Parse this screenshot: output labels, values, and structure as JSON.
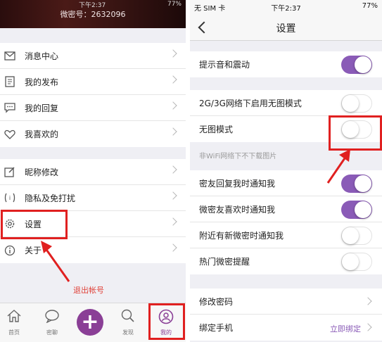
{
  "left": {
    "header": {
      "status_time": "下午2:37",
      "battery": "77%",
      "wechat_id": "微密号：2632096"
    },
    "menu_group1": [
      {
        "label": "消息中心",
        "icon": "envelope-icon"
      },
      {
        "label": "我的发布",
        "icon": "document-icon"
      },
      {
        "label": "我的回复",
        "icon": "comment-icon"
      },
      {
        "label": "我喜欢的",
        "icon": "heart-icon"
      }
    ],
    "menu_group2": [
      {
        "label": "昵称修改",
        "icon": "edit-icon"
      },
      {
        "label": "隐私及免打扰",
        "icon": "privacy-icon"
      },
      {
        "label": "设置",
        "icon": "gear-icon"
      },
      {
        "label": "关于",
        "icon": "info-icon"
      }
    ],
    "logout_label": "退出帐号",
    "tabs": [
      {
        "label": "首页",
        "icon": "home-icon"
      },
      {
        "label": "密聊",
        "icon": "chat-icon"
      },
      {
        "label": "发现",
        "icon": "search-icon"
      },
      {
        "label": "我的",
        "icon": "user-icon"
      }
    ]
  },
  "right": {
    "status": {
      "carrier": "无 SIM 卡",
      "time": "下午2:37",
      "battery": "77%"
    },
    "nav_title": "设置",
    "group1": [
      {
        "label": "提示音和震动",
        "toggle": true
      }
    ],
    "group2": [
      {
        "label": "2G/3G网络下启用无图模式",
        "toggle": false
      },
      {
        "label": "无图模式",
        "toggle": false
      }
    ],
    "hint": "非WiFi网络下不下载图片",
    "group3": [
      {
        "label": "密友回复我时通知我",
        "toggle": true
      },
      {
        "label": "微密友喜欢时通知我",
        "toggle": true
      },
      {
        "label": "附近有新微密时通知我",
        "toggle": false
      },
      {
        "label": "热门微密提醒",
        "toggle": false
      }
    ],
    "group4": [
      {
        "label": "修改密码",
        "value": ""
      },
      {
        "label": "绑定手机",
        "value": "立即绑定"
      }
    ]
  },
  "colors": {
    "accent": "#8a5bb7",
    "plus_button": "#8a3f96",
    "highlight": "#e02020",
    "logout_text": "#e0433a"
  }
}
